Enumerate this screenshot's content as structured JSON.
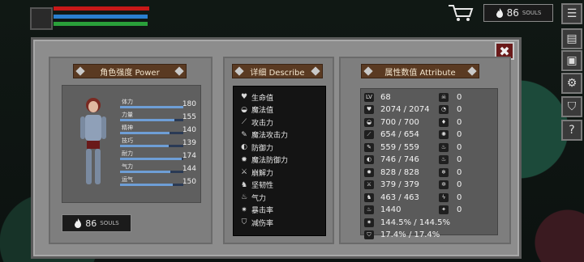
{
  "hud": {
    "souls_value": "86",
    "souls_label": "SOULS"
  },
  "panel": {
    "power_header": "角色强度 Power",
    "describe_header": "详细 Describe",
    "attribute_header": "属性数值 Attribute",
    "close_icon": "close-x-icon"
  },
  "stats": [
    {
      "name": "体力",
      "value": "180",
      "fill": 1.0
    },
    {
      "name": "力量",
      "value": "155",
      "fill": 0.86
    },
    {
      "name": "精神",
      "value": "140",
      "fill": 0.78
    },
    {
      "name": "技巧",
      "value": "139",
      "fill": 0.77
    },
    {
      "name": "耐力",
      "value": "174",
      "fill": 0.97
    },
    {
      "name": "气力",
      "value": "144",
      "fill": 0.8
    },
    {
      "name": "运气",
      "value": "150",
      "fill": 0.83
    }
  ],
  "souls_bottom": {
    "value": "86",
    "label": "SOULS"
  },
  "describe": [
    {
      "icon": "heart-icon",
      "glyph": "♥",
      "label": "生命值"
    },
    {
      "icon": "helmet-icon",
      "glyph": "◒",
      "label": "魔法值"
    },
    {
      "icon": "sword-icon",
      "glyph": "⟋",
      "label": "攻击力"
    },
    {
      "icon": "wand-icon",
      "glyph": "✎",
      "label": "魔法攻击力"
    },
    {
      "icon": "shield-icon",
      "glyph": "◐",
      "label": "防御力"
    },
    {
      "icon": "magic-shield-icon",
      "glyph": "✹",
      "label": "魔法防御力"
    },
    {
      "icon": "break-icon",
      "glyph": "⚔",
      "label": "崩解力"
    },
    {
      "icon": "tenacity-icon",
      "glyph": "♞",
      "label": "坚韧性"
    },
    {
      "icon": "lungs-icon",
      "glyph": "♨",
      "label": "气力"
    },
    {
      "icon": "crit-icon",
      "glyph": "✷",
      "label": "暴击率"
    },
    {
      "icon": "reduction-icon",
      "glyph": "⛉",
      "label": "减伤率"
    }
  ],
  "attributes": [
    {
      "icon": "level-icon",
      "glyph": "LV",
      "value": "68"
    },
    {
      "icon": "heart-icon",
      "glyph": "♥",
      "value": "2074 / 2074"
    },
    {
      "icon": "helmet-icon",
      "glyph": "◒",
      "value": "700 / 700"
    },
    {
      "icon": "sword-icon",
      "glyph": "⟋",
      "value": "654 / 654"
    },
    {
      "icon": "wand-icon",
      "glyph": "✎",
      "value": "559 / 559"
    },
    {
      "icon": "shield-icon",
      "glyph": "◐",
      "value": "746 / 746"
    },
    {
      "icon": "magic-shield-icon",
      "glyph": "✹",
      "value": "828 / 828"
    },
    {
      "icon": "break-icon",
      "glyph": "⚔",
      "value": "379 / 379"
    },
    {
      "icon": "tenacity-icon",
      "glyph": "♞",
      "value": "463 / 463"
    },
    {
      "icon": "lungs-icon",
      "glyph": "♨",
      "value": "1440"
    },
    {
      "icon": "crit-icon",
      "glyph": "✷",
      "value": "144.5% / 144.5%"
    },
    {
      "icon": "reduction-icon",
      "glyph": "⛉",
      "value": "17.4% / 17.4%"
    }
  ],
  "resistances": [
    {
      "icon": "skull-icon",
      "glyph": "☠",
      "value": "0"
    },
    {
      "icon": "drop-icon",
      "glyph": "◔",
      "value": "0"
    },
    {
      "icon": "blood-drop-icon",
      "glyph": "♦",
      "value": "0"
    },
    {
      "icon": "curse-icon",
      "glyph": "✺",
      "value": "0"
    },
    {
      "icon": "fire-icon",
      "glyph": "♨",
      "value": "0"
    },
    {
      "icon": "fire-alt-icon",
      "glyph": "♨",
      "value": "0"
    },
    {
      "icon": "frost-icon",
      "glyph": "❄",
      "value": "0"
    },
    {
      "icon": "ice-icon",
      "glyph": "✲",
      "value": "0"
    },
    {
      "icon": "lightning-icon",
      "glyph": "ϟ",
      "value": "0"
    },
    {
      "icon": "poison-icon",
      "glyph": "✦",
      "value": "0"
    }
  ],
  "side_buttons": [
    {
      "icon": "menu-icon",
      "glyph": "☰"
    },
    {
      "icon": "scroll-icon",
      "glyph": "▤"
    },
    {
      "icon": "armor-icon",
      "glyph": "▣"
    },
    {
      "icon": "gear-icon",
      "glyph": "⚙"
    },
    {
      "icon": "shield-button-icon",
      "glyph": "⛉"
    },
    {
      "icon": "help-icon",
      "glyph": "?"
    }
  ],
  "colors": {
    "hp": "#c81818",
    "mp": "#2a7fd0",
    "xp": "#2aa03a",
    "header": "#5a3a22",
    "bar_fill": "#6e9ed6"
  }
}
